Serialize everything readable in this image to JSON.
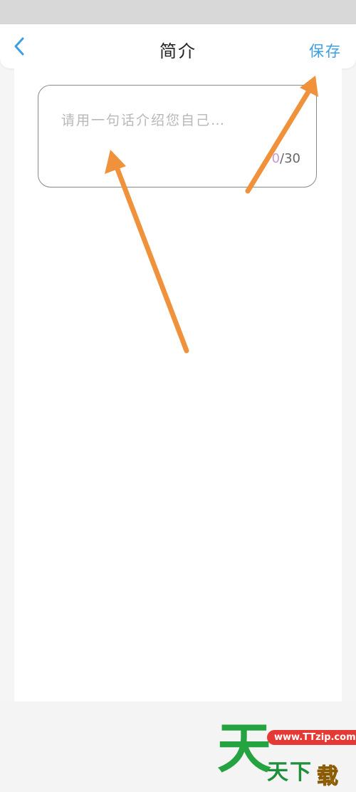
{
  "header": {
    "back_icon": "chevron-left-icon",
    "title": "简介",
    "save_label": "保存",
    "accent_color": "#3e9fe0"
  },
  "intro": {
    "placeholder": "请用一句话介绍您自己…",
    "value": "",
    "count_current": "0",
    "count_max": "/30"
  },
  "watermark": {
    "big_char": "天",
    "url": "www.TTzip.com",
    "small_text": "天下",
    "badge": "载"
  },
  "annotation_color": "#f0923c"
}
